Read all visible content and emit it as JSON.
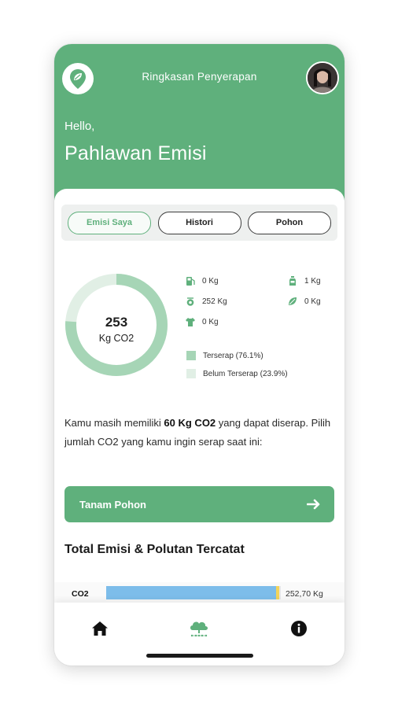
{
  "header": {
    "title": "Ringkasan Penyerapan",
    "greeting": "Hello,",
    "name": "Pahlawan Emisi"
  },
  "tabs": [
    {
      "label": "Emisi Saya",
      "active": true
    },
    {
      "label": "Histori",
      "active": false
    },
    {
      "label": "Pohon",
      "active": false
    }
  ],
  "summary": {
    "total_value": "253",
    "total_unit": "Kg CO2",
    "absorbed_fraction": 0.761,
    "stats": [
      {
        "icon": "fuel-icon",
        "value": "0 Kg"
      },
      {
        "icon": "bottle-icon",
        "value": "1 Kg"
      },
      {
        "icon": "food-icon",
        "value": "252 Kg"
      },
      {
        "icon": "leaf-icon",
        "value": "0 Kg"
      },
      {
        "icon": "shirt-icon",
        "value": "0 Kg"
      }
    ],
    "legend": [
      {
        "label": "Terserap (76.1%)",
        "color": "#a6d5b6"
      },
      {
        "label": "Belum Terserap (23.9%)",
        "color": "#e1efe5"
      }
    ]
  },
  "message": {
    "before": "Kamu masih memiliki ",
    "highlight": "60 Kg CO2",
    "after": " yang dapat diserap. Pilih jumlah CO2 yang kamu ingin serap saat ini:"
  },
  "cta": {
    "label": "Tanam Pohon"
  },
  "emissions": {
    "title": "Total Emisi & Polutan Tercatat",
    "rows": [
      {
        "label": "CO2",
        "value": "252,70 Kg",
        "fill": 0.99
      }
    ]
  },
  "nav": {
    "items": [
      "home-icon",
      "tree-icon",
      "info-icon"
    ]
  },
  "colors": {
    "primary": "#5fb07c",
    "donut_fill": "#a6d5b6",
    "donut_track": "#e1efe5",
    "bar_fill": "#7dbdea"
  }
}
